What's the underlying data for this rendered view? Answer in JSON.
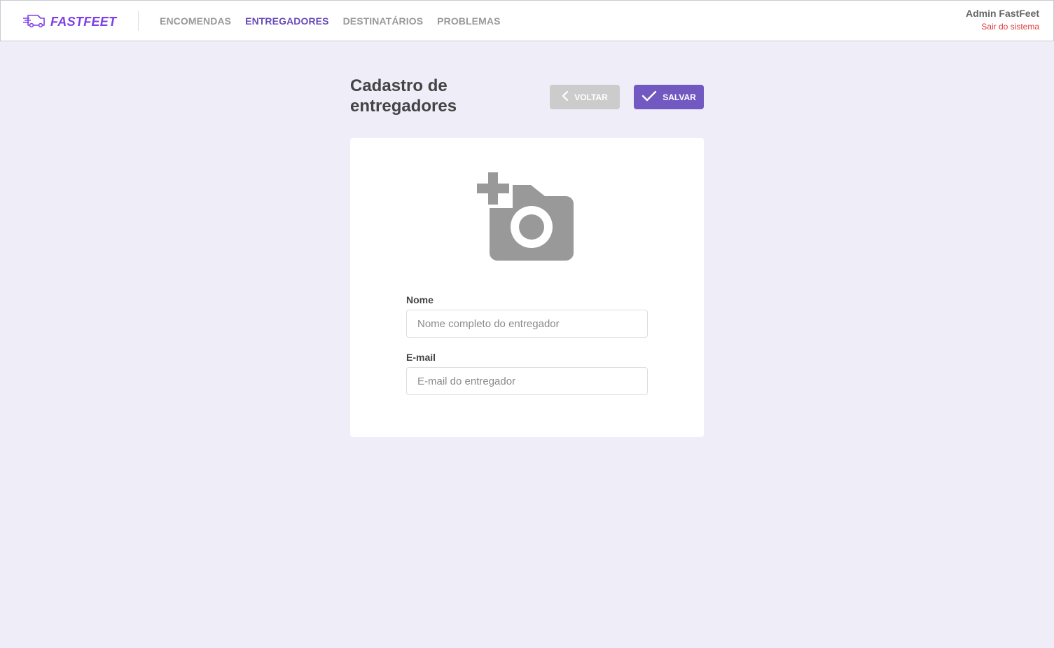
{
  "brand": {
    "name": "FASTFEET",
    "color": "#7D40E7"
  },
  "nav": {
    "items": [
      {
        "label": "ENCOMENDAS",
        "active": false
      },
      {
        "label": "ENTREGADORES",
        "active": true
      },
      {
        "label": "DESTINATÁRIOS",
        "active": false
      },
      {
        "label": "PROBLEMAS",
        "active": false
      }
    ]
  },
  "user": {
    "name": "Admin FastFeet",
    "logout_label": "Sair do sistema"
  },
  "page": {
    "title": "Cadastro de entregadores"
  },
  "actions": {
    "back_label": "VOLTAR",
    "save_label": "SALVAR"
  },
  "form": {
    "avatar_icon": "add-photo-icon",
    "name": {
      "label": "Nome",
      "placeholder": "Nome completo do entregador",
      "value": ""
    },
    "email": {
      "label": "E-mail",
      "placeholder": "E-mail do entregador",
      "value": ""
    }
  },
  "colors": {
    "background": "#EFEDF8",
    "accent": "#7159C1",
    "logout": "#DE3B3B",
    "back_button": "#CCCCCC"
  }
}
